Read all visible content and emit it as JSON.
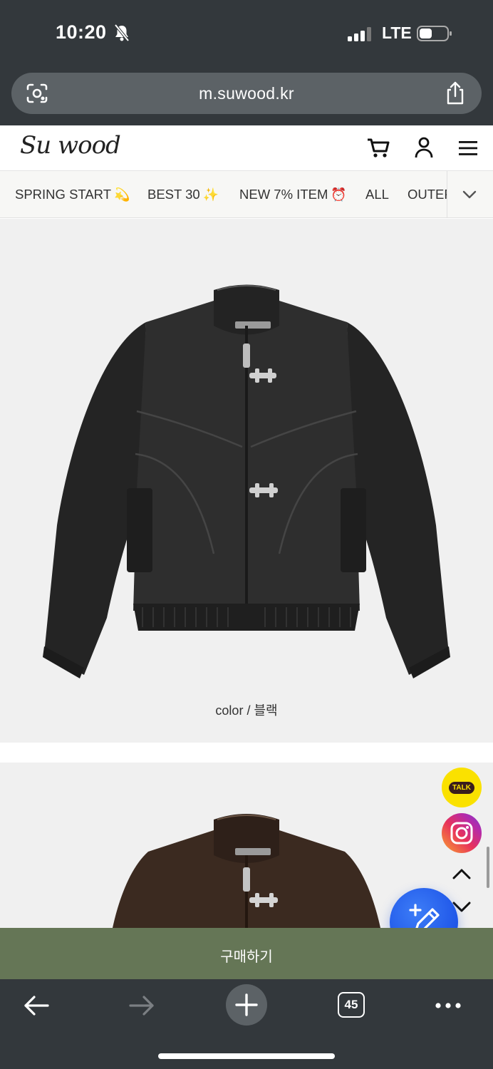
{
  "status_bar": {
    "time": "10:20",
    "network": "LTE",
    "icons": [
      "bell-slash-icon",
      "signal-icon",
      "battery-icon"
    ]
  },
  "browser": {
    "url": "m.suwood.kr",
    "tab_count": "45"
  },
  "site": {
    "logo_text": "Su wood",
    "header_icons": [
      "cart-icon",
      "user-icon",
      "menu-icon"
    ]
  },
  "categories": [
    {
      "label": "SPRING START",
      "emoji": "💫"
    },
    {
      "label": "BEST 30",
      "emoji": "✨"
    },
    {
      "label": "NEW 7% ITEM",
      "emoji": "⏰"
    },
    {
      "label": "ALL",
      "emoji": ""
    },
    {
      "label": "OUTER",
      "emoji": ""
    }
  ],
  "product": {
    "color_caption": "color / 블랙",
    "image_1_color": "#2b2b2b",
    "image_2_color": "#3b2a20"
  },
  "floating": {
    "talk_label": "TALK"
  },
  "buy_bar": {
    "label": "구매하기",
    "color": "#657656"
  }
}
